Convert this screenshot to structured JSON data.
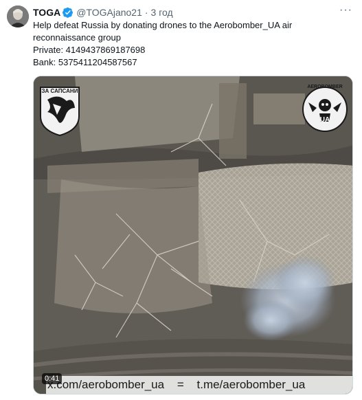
{
  "tweet": {
    "author_name": "TOGA",
    "handle": "@TOGAjano21",
    "separator": "·",
    "time": "3 год",
    "more_label": "···",
    "text_lines": [
      "Help defeat Russia by donating drones to the Aerobomber_UA air",
      "reconnaissance group",
      "Private: 4149437869187698",
      "Bank: 5375411204587567"
    ]
  },
  "media": {
    "duration": "0:41",
    "watermark_left": "x.com/aerobomber_ua",
    "watermark_eq": "=",
    "watermark_right": "t.me/aerobomber_ua",
    "logo_left_text": "ЗА САПСАНИ",
    "logo_right_top": "AEROBOMBER",
    "logo_right_bottom": "UA"
  },
  "colors": {
    "verified": "#1d9bf0",
    "text": "#0f1419",
    "secondary": "#536471"
  },
  "icons": {
    "verified": "verified-badge-icon",
    "more": "more-options-icon"
  }
}
